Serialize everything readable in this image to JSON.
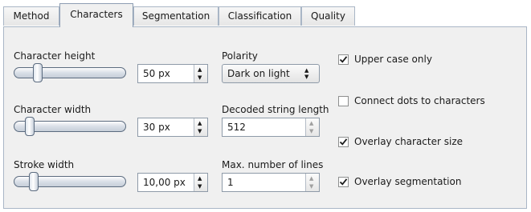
{
  "tabs": [
    {
      "label": "Method",
      "active": false
    },
    {
      "label": "Characters",
      "active": true
    },
    {
      "label": "Segmentation",
      "active": false
    },
    {
      "label": "Classification",
      "active": false
    },
    {
      "label": "Quality",
      "active": false
    }
  ],
  "sliders": {
    "character_height": {
      "label": "Character height",
      "value": "50 px",
      "level": 0.18
    },
    "character_width": {
      "label": "Character width",
      "value": "30 px",
      "level": 0.1
    },
    "stroke_width": {
      "label": "Stroke width",
      "value": "10,00 px",
      "level": 0.14
    }
  },
  "polarity": {
    "label": "Polarity",
    "value": "Dark on light"
  },
  "decoded_length": {
    "label": "Decoded string length",
    "value": "512"
  },
  "max_lines": {
    "label": "Max. number of lines",
    "value": "1"
  },
  "checkboxes": {
    "upper_case": {
      "label": "Upper case only",
      "checked": true
    },
    "connect_dots": {
      "label": "Connect dots to characters",
      "checked": false
    },
    "overlay_size": {
      "label": "Overlay character size",
      "checked": true
    },
    "overlay_segmentation": {
      "label": "Overlay segmentation",
      "checked": true
    }
  },
  "icons": {
    "spin_up": "▲",
    "spin_down": "▼",
    "check": "checkmark-icon"
  }
}
